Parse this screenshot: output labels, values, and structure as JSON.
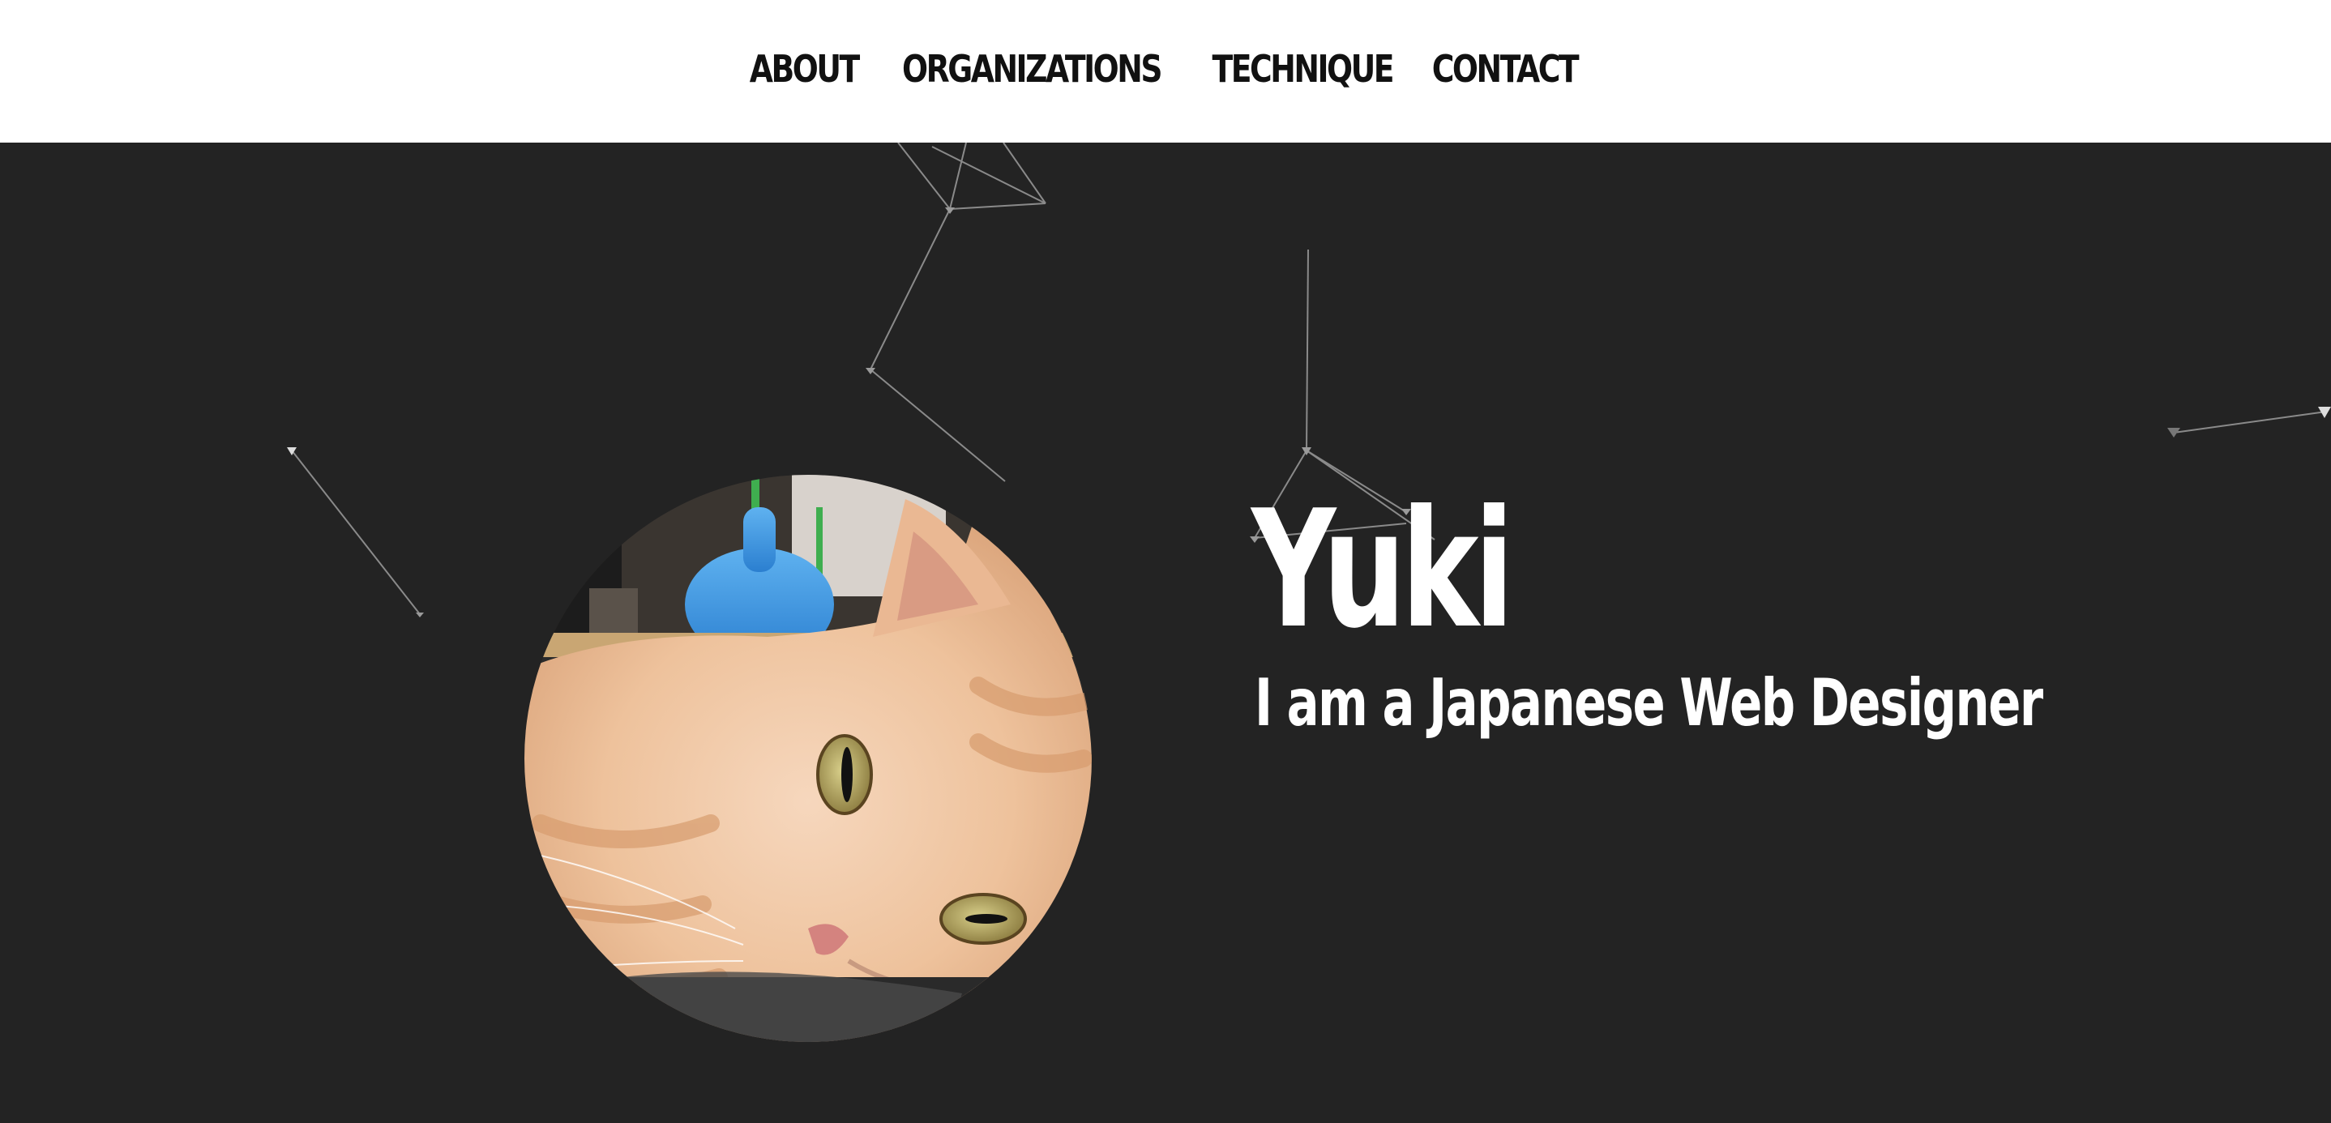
{
  "nav": {
    "items": [
      {
        "label": "ABOUT"
      },
      {
        "label": "ORGANIZATIONS"
      },
      {
        "label": "TECHNIQUE"
      },
      {
        "label": "CONTACT"
      }
    ]
  },
  "hero": {
    "name": "Yuki",
    "tagline": "I am a Japanese Web Designer",
    "avatar_alt": "cat-photo",
    "background_color": "#232323",
    "text_color": "#ffffff"
  },
  "theme": {
    "nav_background": "#ffffff",
    "nav_text": "#111111",
    "particle_line_color": "#8a8a8a"
  }
}
